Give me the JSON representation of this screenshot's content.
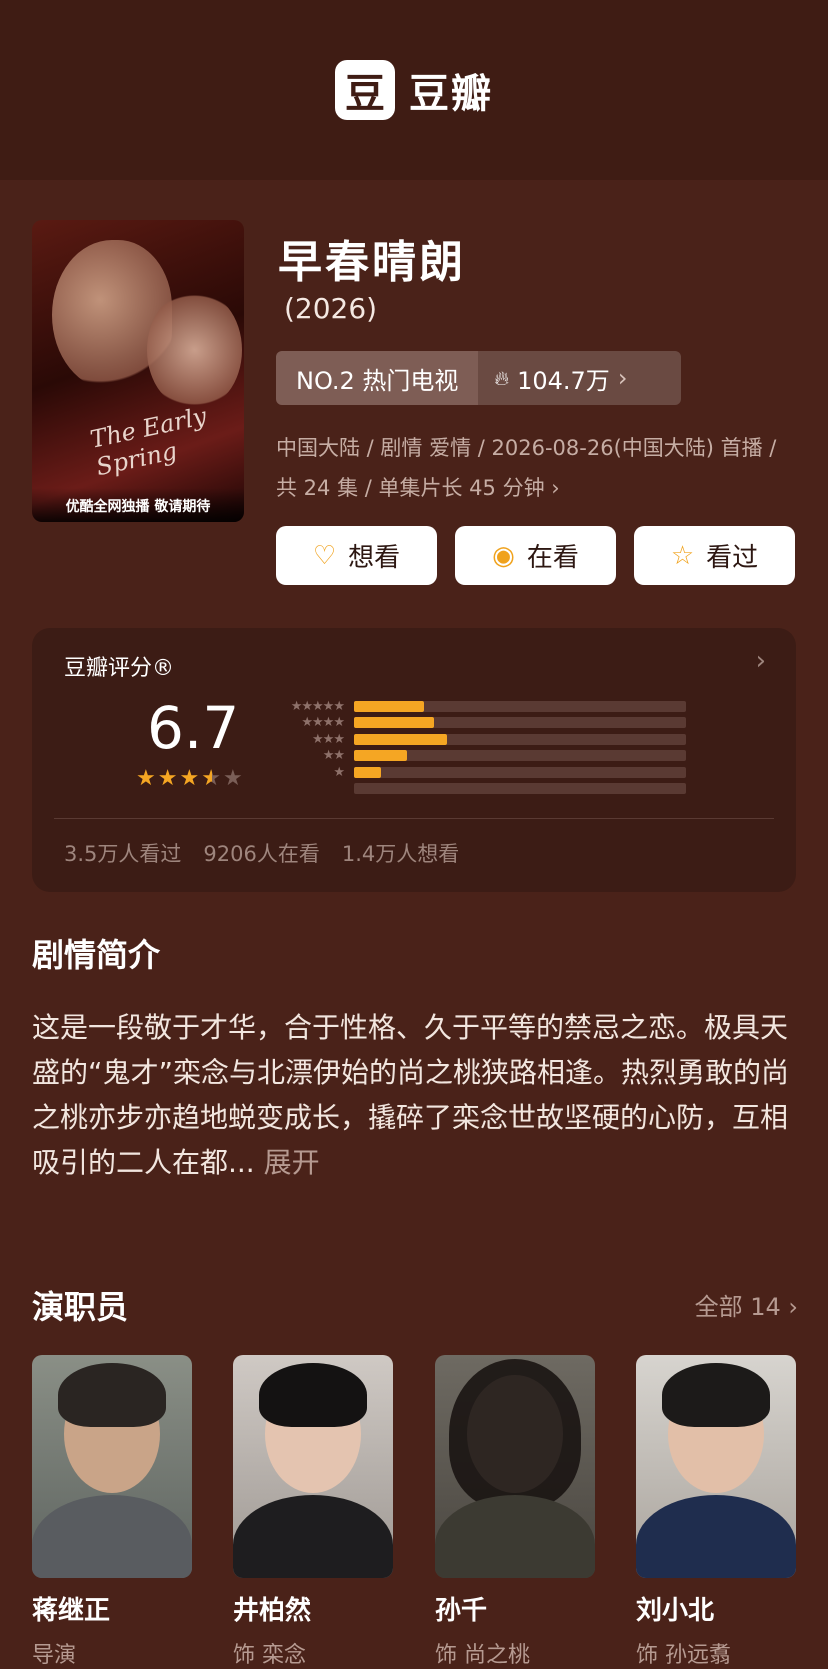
{
  "app": {
    "logo_glyph": "豆",
    "logo_text": "豆瓣"
  },
  "poster": {
    "title_script": "The Early Spring",
    "bottom_text": "优酷全网独播 敬请期待"
  },
  "show": {
    "title": "早春晴朗",
    "year": "(2026)",
    "rank_label": "NO.2 热门电视",
    "heat": "104.7万",
    "meta": "中国大陆 / 剧情 爱情 / 2026-08-26(中国大陆) 首播 / 共 24 集 / 单集片长 45 分钟"
  },
  "actions": [
    {
      "label": "想看",
      "icon": "heart-plus-icon"
    },
    {
      "label": "在看",
      "icon": "target-icon"
    },
    {
      "label": "看过",
      "icon": "star-outline-icon"
    }
  ],
  "rating": {
    "title": "豆瓣评分®",
    "score": "6.7",
    "stars_filled": 3.5,
    "distribution": [
      {
        "stars": "★★★★★",
        "fraction": 0.21
      },
      {
        "stars": "★★★★",
        "fraction": 0.24
      },
      {
        "stars": "★★★",
        "fraction": 0.28
      },
      {
        "stars": "★★",
        "fraction": 0.16
      },
      {
        "stars": "★",
        "fraction": 0.08
      },
      {
        "stars": "",
        "fraction": 0.0
      }
    ],
    "watched": "3.5万人看过",
    "watching": "9206人在看",
    "want": "1.4万人想看"
  },
  "synopsis": {
    "title": "剧情简介",
    "text": "这是一段敬于才华，合于性格、久于平等的禁忌之恋。极具天盛的“鬼才”栾念与北漂伊始的尚之桃狭路相逢。热烈勇敢的尚之桃亦步亦趋地蜕变成长，撬碎了栾念世故坚硬的心防，互相吸引的二人在都... ",
    "expand": "展开"
  },
  "cast": {
    "title": "演职员",
    "all_label": "全部 14 ›",
    "members": [
      {
        "name": "蒋继正",
        "role": "导演"
      },
      {
        "name": "井柏然",
        "role": "饰 栾念"
      },
      {
        "name": "孙千",
        "role": "饰 尚之桃"
      },
      {
        "name": "刘小北",
        "role": "饰 孙远翥"
      }
    ]
  }
}
